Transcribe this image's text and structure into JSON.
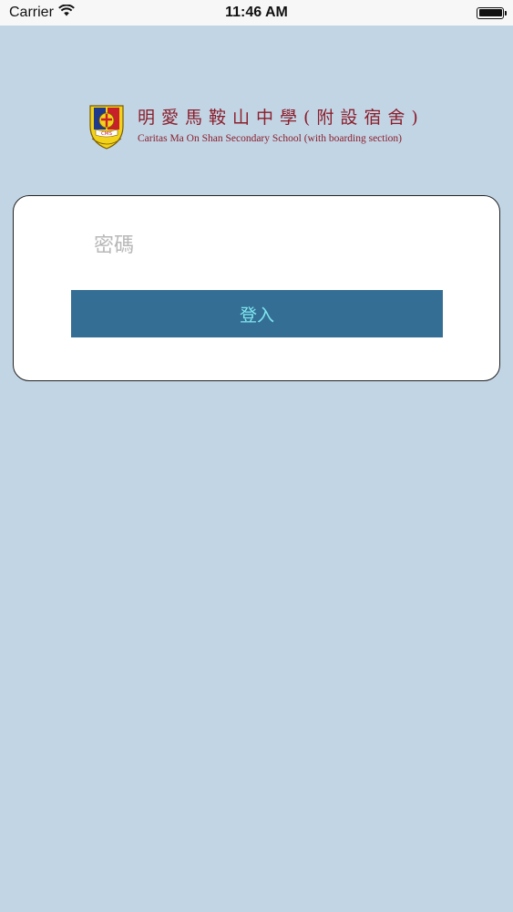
{
  "status_bar": {
    "carrier": "Carrier",
    "time": "11:46 AM"
  },
  "header": {
    "crest_text": "CMS",
    "school_name_zh": "明愛馬鞍山中學(附設宿舍)",
    "school_name_en": "Caritas Ma On Shan Secondary School (with boarding section)"
  },
  "login": {
    "password_placeholder": "密碼",
    "password_value": "",
    "login_label": "登入"
  },
  "colors": {
    "background": "#c2d5e5",
    "button": "#356e94",
    "button_text": "#7ee7ef",
    "school_text": "#8b1e2b"
  }
}
